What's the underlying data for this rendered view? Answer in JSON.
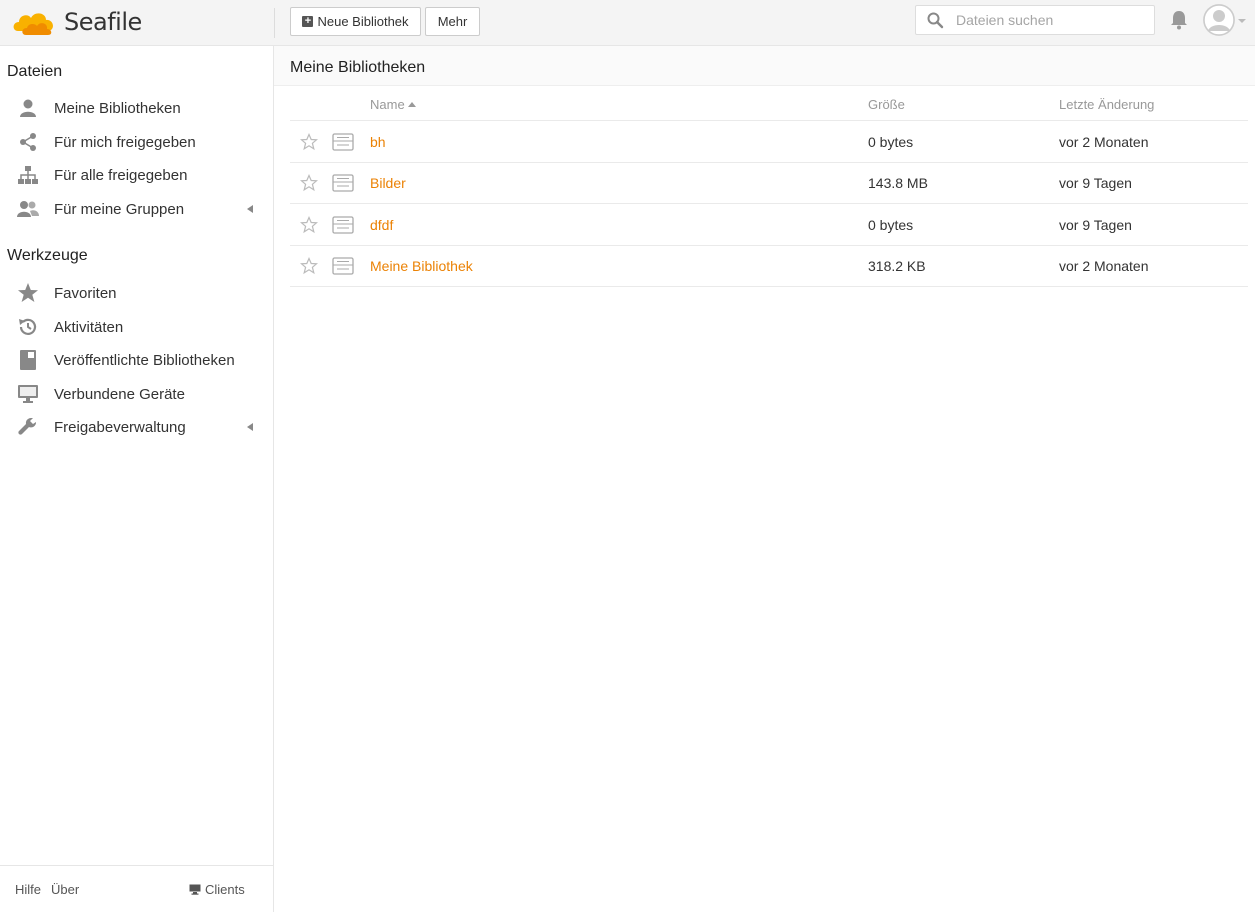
{
  "header": {
    "brand": "Seafile",
    "new_library_label": "Neue Bibliothek",
    "more_label": "Mehr",
    "search_placeholder": "Dateien suchen"
  },
  "sidebar": {
    "files_heading": "Dateien",
    "files_items": [
      {
        "label": "Meine Bibliotheken",
        "icon": "user-icon"
      },
      {
        "label": "Für mich freigegeben",
        "icon": "share-icon"
      },
      {
        "label": "Für alle freigegeben",
        "icon": "org-icon"
      },
      {
        "label": "Für meine Gruppen",
        "icon": "group-icon"
      }
    ],
    "tools_heading": "Werkzeuge",
    "tools_items": [
      {
        "label": "Favoriten",
        "icon": "star-icon"
      },
      {
        "label": "Aktivitäten",
        "icon": "history-icon"
      },
      {
        "label": "Veröffentlichte Bibliotheken",
        "icon": "book-icon"
      },
      {
        "label": "Verbundene Geräte",
        "icon": "monitor-icon"
      },
      {
        "label": "Freigabeverwaltung",
        "icon": "wrench-icon"
      }
    ],
    "footer": {
      "help": "Hilfe",
      "about": "Über",
      "clients": "Clients"
    }
  },
  "main": {
    "title": "Meine Bibliotheken",
    "columns": {
      "name": "Name",
      "size": "Größe",
      "modified": "Letzte Änderung"
    },
    "rows": [
      {
        "name": "bh",
        "size": "0 bytes",
        "modified": "vor 2 Monaten"
      },
      {
        "name": "Bilder",
        "size": "143.8 MB",
        "modified": "vor 9 Tagen"
      },
      {
        "name": "dfdf",
        "size": "0 bytes",
        "modified": "vor 9 Tagen"
      },
      {
        "name": "Meine Bibliothek",
        "size": "318.2 KB",
        "modified": "vor 2 Monaten"
      }
    ]
  },
  "colors": {
    "accent": "#eb8205",
    "brand_orange": "#f5a623"
  }
}
